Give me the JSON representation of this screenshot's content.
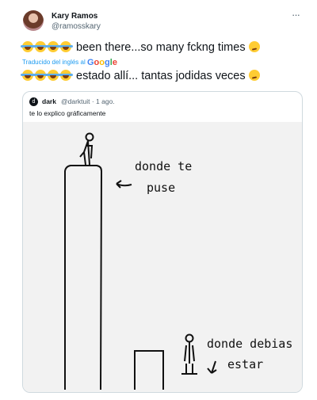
{
  "author": {
    "name": "Kary Ramos",
    "handle": "@ramosskary"
  },
  "menu_icon": "more-horizontal-icon",
  "tweet": {
    "original_text": "been there...so many fckng times",
    "translation_label": "Traducido del inglés al",
    "translation_provider": "Google",
    "translated_text": "estado allí... tantas jodidas veces"
  },
  "quoted": {
    "name": "dark",
    "handle_time": "@darktuit · 1 ago.",
    "text": "te lo explico gráficamente",
    "drawing": {
      "label_top_line1": "donde te",
      "label_top_line2": "puse",
      "label_bottom_line1": "donde debias",
      "label_bottom_line2": "estar"
    }
  },
  "colors": {
    "link": "#1d9bf0",
    "secondary_text": "#536471",
    "border": "#cfd9de"
  }
}
